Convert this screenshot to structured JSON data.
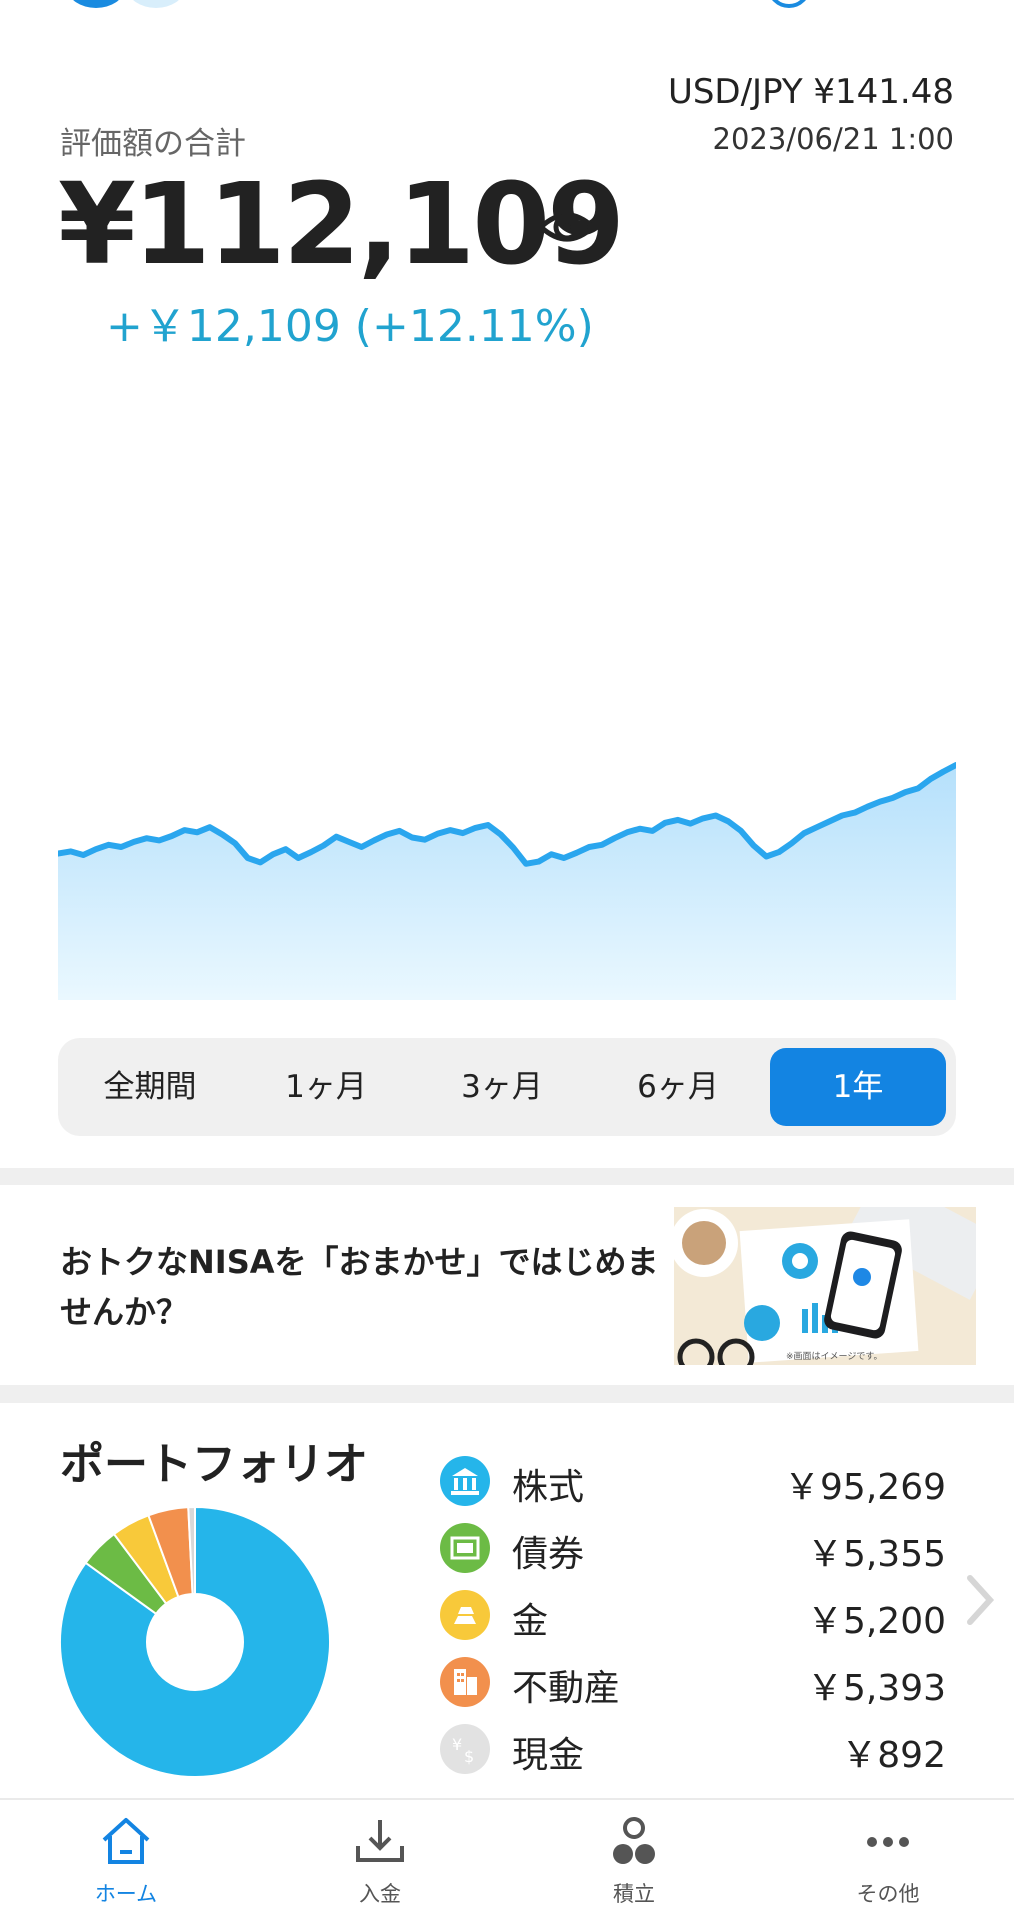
{
  "header": {
    "fx_rate": "USD/JPY ¥141.48",
    "timestamp": "2023/06/21 1:00"
  },
  "summary": {
    "label": "評価額の合計",
    "total": "¥112,109",
    "gain": "+￥12,109 (+12.11%)"
  },
  "chart_data": {
    "type": "area",
    "title": "",
    "xlabel": "",
    "ylabel": "",
    "period": "1年",
    "note": "relative values, no axis shown",
    "values": [
      100,
      100.3,
      99.8,
      100.6,
      101.2,
      100.9,
      101.6,
      102.1,
      101.8,
      102.4,
      103.2,
      102.9,
      103.6,
      102.6,
      101.4,
      99.4,
      98.8,
      99.9,
      100.6,
      99.4,
      100.2,
      101.1,
      102.3,
      101.6,
      100.9,
      101.8,
      102.6,
      103.1,
      102.2,
      101.9,
      102.7,
      103.2,
      102.8,
      103.5,
      103.9,
      102.6,
      100.8,
      98.6,
      98.9,
      99.9,
      99.4,
      100.1,
      100.9,
      101.2,
      102.1,
      102.9,
      103.4,
      103.1,
      104.2,
      104.6,
      104.1,
      104.8,
      105.2,
      104.4,
      103.1,
      101.1,
      99.6,
      100.2,
      101.4,
      102.8,
      103.6,
      104.4,
      105.2,
      105.6,
      106.4,
      107.1,
      107.6,
      108.4,
      108.9,
      110.2,
      111.2,
      112.1
    ]
  },
  "periods": {
    "all": "全期間",
    "m1": "1ヶ月",
    "m3": "3ヶ月",
    "m6": "6ヶ月",
    "y1": "1年"
  },
  "banner": {
    "text": "おトクなNISAを「おまかせ」ではじめませんか？",
    "image_caption": "※画面はイメージです。"
  },
  "portfolio": {
    "title": "ポートフォリオ",
    "assets": [
      {
        "name": "株式",
        "value": "￥95,269",
        "amount": 95269,
        "color": "#25b5ea",
        "icon": "bank-icon"
      },
      {
        "name": "債券",
        "value": "￥5,355",
        "amount": 5355,
        "color": "#6cbb45",
        "icon": "bond-icon"
      },
      {
        "name": "金",
        "value": "￥5,200",
        "amount": 5200,
        "color": "#f8c93a",
        "icon": "gold-icon"
      },
      {
        "name": "不動産",
        "value": "￥5,393",
        "amount": 5393,
        "color": "#f2904d",
        "icon": "building-icon"
      },
      {
        "name": "現金",
        "value": "￥892",
        "amount": 892,
        "color": "#d8d8d8",
        "icon": "cash-icon"
      }
    ]
  },
  "nav": {
    "home": "ホーム",
    "deposit": "入金",
    "savings": "積立",
    "other": "その他"
  },
  "colors": {
    "accent": "#1384e2",
    "gain": "#21a3cf",
    "chart_line": "#2aa6ee"
  }
}
